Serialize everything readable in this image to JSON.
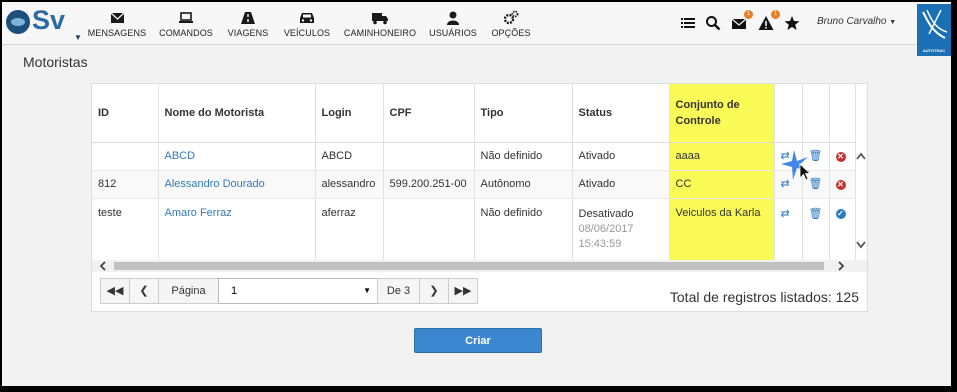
{
  "app": {
    "logo_text": "Sv",
    "user_name": "Bruno Carvalho",
    "brand_text": "AUTOTRAC"
  },
  "nav": [
    {
      "label": "MENSAGENS",
      "icon": "envelope-icon"
    },
    {
      "label": "COMANDOS",
      "icon": "laptop-icon"
    },
    {
      "label": "VIAGENS",
      "icon": "road-icon"
    },
    {
      "label": "VEÍCULOS",
      "icon": "car-icon"
    },
    {
      "label": "CAMINHONEIRO",
      "icon": "truck-icon"
    },
    {
      "label": "USUÁRIOS",
      "icon": "user-icon"
    },
    {
      "label": "OPÇÕES",
      "icon": "cogs-icon"
    }
  ],
  "toolbar": {
    "messages_badge": "1",
    "alerts_badge": "1"
  },
  "page": {
    "title": "Motoristas"
  },
  "table": {
    "headers": [
      "ID",
      "Nome do Motorista",
      "Login",
      "CPF",
      "Tipo",
      "Status",
      "Conjunto de Controle"
    ],
    "rows": [
      {
        "id": "",
        "nome": "ABCD",
        "login": "ABCD",
        "cpf": "",
        "tipo": "Não definido",
        "status": "Ativado",
        "status_date": "",
        "conjunto": "aaaa"
      },
      {
        "id": "812",
        "nome": "Alessandro Dourado",
        "login": "alessandro",
        "cpf": "599.200.251-00",
        "tipo": "Autônomo",
        "status": "Ativado",
        "status_date": "",
        "conjunto": "CC"
      },
      {
        "id": "teste",
        "nome": "Amaro Ferraz",
        "login": "aferraz",
        "cpf": "",
        "tipo": "Não definido",
        "status": "Desativado",
        "status_date": "08/06/2017 15:43:59",
        "conjunto": "Veiculos da Karla"
      }
    ]
  },
  "pagination": {
    "page_label": "Página",
    "current_page": "1",
    "of_label": "De 3",
    "total_text": "Total de registros listados: 125"
  },
  "actions": {
    "create_label": "Criar"
  },
  "colors": {
    "highlight": "#fbfb57",
    "link": "#337ab7",
    "primary_button": "#3b87d0",
    "badge": "#e67e22"
  }
}
